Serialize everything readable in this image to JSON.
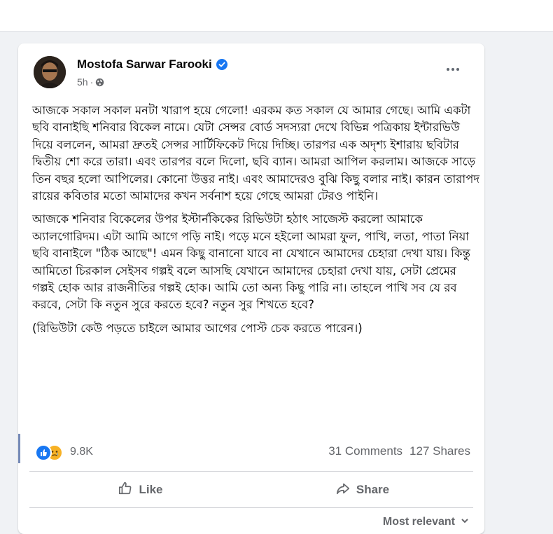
{
  "post": {
    "author": "Mostofa Sarwar Farooki",
    "time": "5h",
    "separator": "·",
    "paragraphs": [
      "আজকে সকাল সকাল মনটা খারাপ হয়ে গেলো! এরকম কত সকাল যে আমার গেছে। আমি একটা ছবি বানাইছি শনিবার বিকেল নামে। যেটা সেন্সর বোর্ড সদস্যরা দেখে বিভিন্ন পত্রিকায় ইন্টারভিউ দিয়ে বললেন, আমরা দ্রুতই সেন্সর সার্টিফিকেট দিয়ে দিচ্ছি। তারপর এক অদৃশ্য ইশারায় ছবিটার দ্বিতীয় শো করে তারা। এবং তারপর বলে দিলো, ছবি ব্যান। আমরা আপিল করলাম। আজকে সাড়ে তিন বছর হলো আপিলের। কোনো উত্তর নাই। এবং আমাদেরও বুঝি কিছু বলার নাই। কারন তারাপদ রায়ের কবিতার মতো আমাদের কখন সর্বনাশ হয়ে গেছে আমরা টেরও পাইনি।",
      "আজকে শনিবার বিকেলের উপর ইস্টার্নকিকের রিভিউটা হঠাৎ সাজেস্ট করলো আমাকে অ্যালগোরিদম। এটা আমি আগে পড়ি নাই। পড়ে মনে হইলো আমরা ফুল, পাখি, লতা, পাতা নিয়া ছবি বানাইলে \"ঠিক আছে\"! এমন কিছু বানানো যাবে না যেখানে আমাদের চেহারা দেখা যায়। কিন্তু আমিতো চিরকাল সেইসব গল্পই বলে আসছি যেখানে আমাদের চেহারা দেখা যায়, সেটা প্রেমের গল্পই হোক আর রাজনীতির গল্পই হোক। আমি তো অন্য কিছু পারি না। তাহলে পাখি সব যে রব করবে, সেটা কি নতুন সুরে করতে হবে? নতুন সুর শিখতে হবে?",
      "(রিভিউটা কেউ পড়তে চাইলে আমার আগের পোস্ট চেক করতে পারেন।)"
    ]
  },
  "stats": {
    "reactions": "9.8K",
    "comments": "31 Comments",
    "shares": "127 Shares"
  },
  "actions": {
    "like": "Like",
    "share": "Share"
  },
  "sort": {
    "label": "Most relevant"
  },
  "colors": {
    "accent": "#1877f2",
    "verified": "#1877f2",
    "secondary_text": "#65676b",
    "background": "#f0f2f5"
  },
  "icons": [
    "verified-icon",
    "globe-icon",
    "more-icon",
    "like-reaction-icon",
    "sad-reaction-icon",
    "like-icon",
    "share-icon",
    "chevron-down-icon"
  ]
}
